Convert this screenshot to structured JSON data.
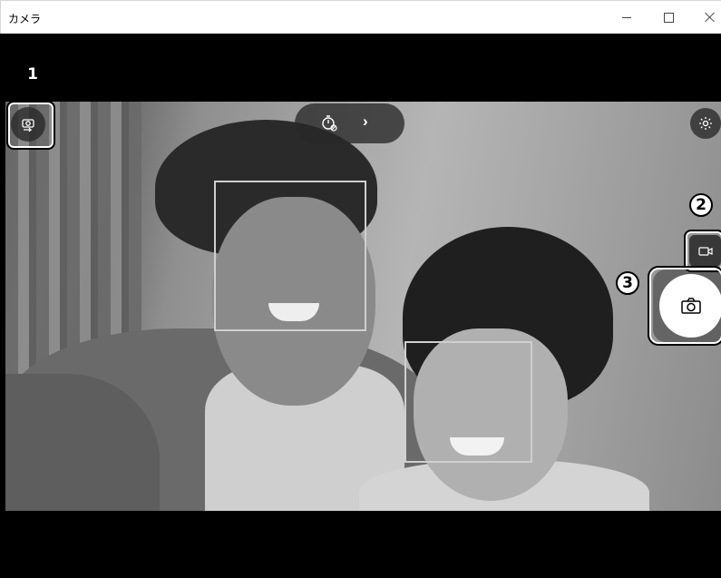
{
  "window": {
    "title": "カメラ",
    "minimize_icon": "minimize-icon",
    "maximize_icon": "maximize-icon",
    "close_icon": "close-icon"
  },
  "toolbar": {
    "switch_camera_icon": "camera-switch-icon",
    "timer_icon": "timer-off-icon",
    "expand_chevron": "›",
    "settings_icon": "gear-icon"
  },
  "capture": {
    "video_mode_icon": "video-camera-icon",
    "shutter_icon": "camera-icon"
  },
  "callouts": [
    "1",
    "2",
    "3"
  ],
  "colors": {
    "titlebar": "#ffffff",
    "background": "#000000",
    "control_bg": "#282828",
    "shutter": "#ffffff",
    "face_box": "#cfcfcf"
  }
}
